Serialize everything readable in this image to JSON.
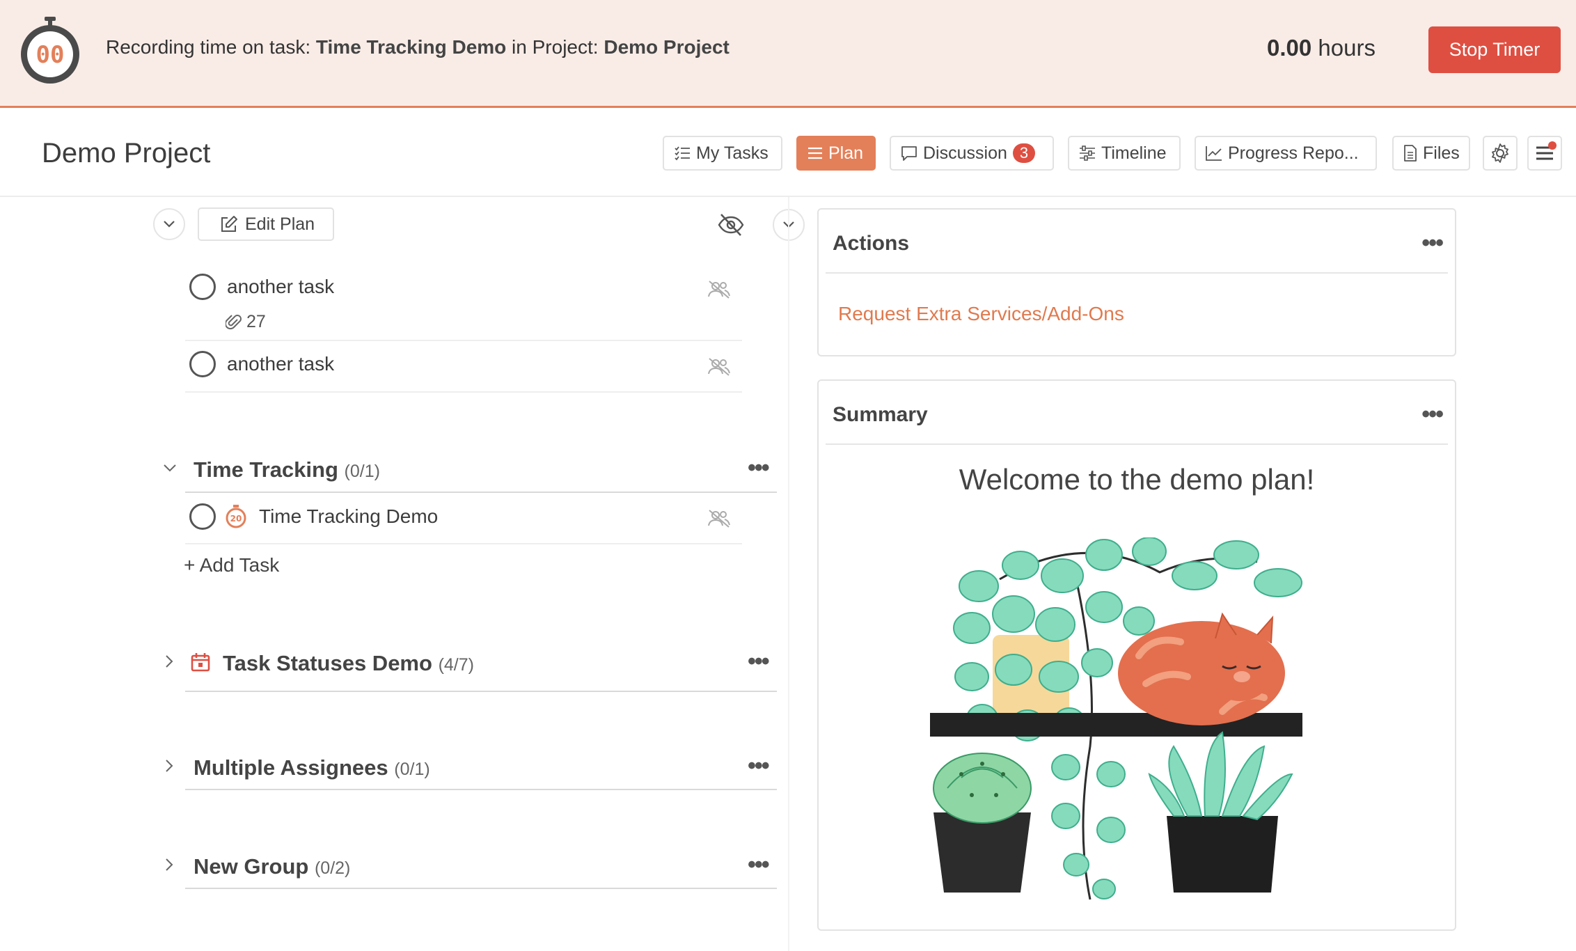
{
  "banner": {
    "prefix": "Recording time on task: ",
    "task": "Time Tracking Demo",
    "mid": " in Project: ",
    "project": "Demo Project",
    "hours_value": "0.00",
    "hours_unit": " hours",
    "stop_label": "Stop Timer",
    "stopwatch_digits": "00"
  },
  "header": {
    "title": "Demo Project",
    "tabs": [
      {
        "label": "My Tasks"
      },
      {
        "label": "Plan"
      },
      {
        "label": "Discussion",
        "badge": "3"
      },
      {
        "label": "Timeline"
      },
      {
        "label": "Progress Repo..."
      },
      {
        "label": "Files"
      }
    ]
  },
  "plan": {
    "edit_label": "Edit Plan",
    "tasks_top": [
      {
        "name": "another task",
        "attachments": "27"
      },
      {
        "name": "another task"
      }
    ],
    "groups": [
      {
        "name": "Time Tracking",
        "count": "(0/1)"
      },
      {
        "name": "Task Statuses Demo",
        "count": "(4/7)"
      },
      {
        "name": "Multiple Assignees",
        "count": "(0/1)"
      },
      {
        "name": "New Group",
        "count": "(0/2)"
      }
    ],
    "time_task": {
      "name": "Time Tracking Demo",
      "timer_digits": "20"
    },
    "add_task": "+ Add Task",
    "menu_glyph": "•••"
  },
  "actions": {
    "title": "Actions",
    "link": "Request Extra Services/Add-Ons"
  },
  "summary": {
    "title": "Summary",
    "welcome": "Welcome to the demo plan!"
  },
  "colors": {
    "accent": "#e38059",
    "danger": "#de4f42",
    "banner_bg": "#f9ece7"
  }
}
